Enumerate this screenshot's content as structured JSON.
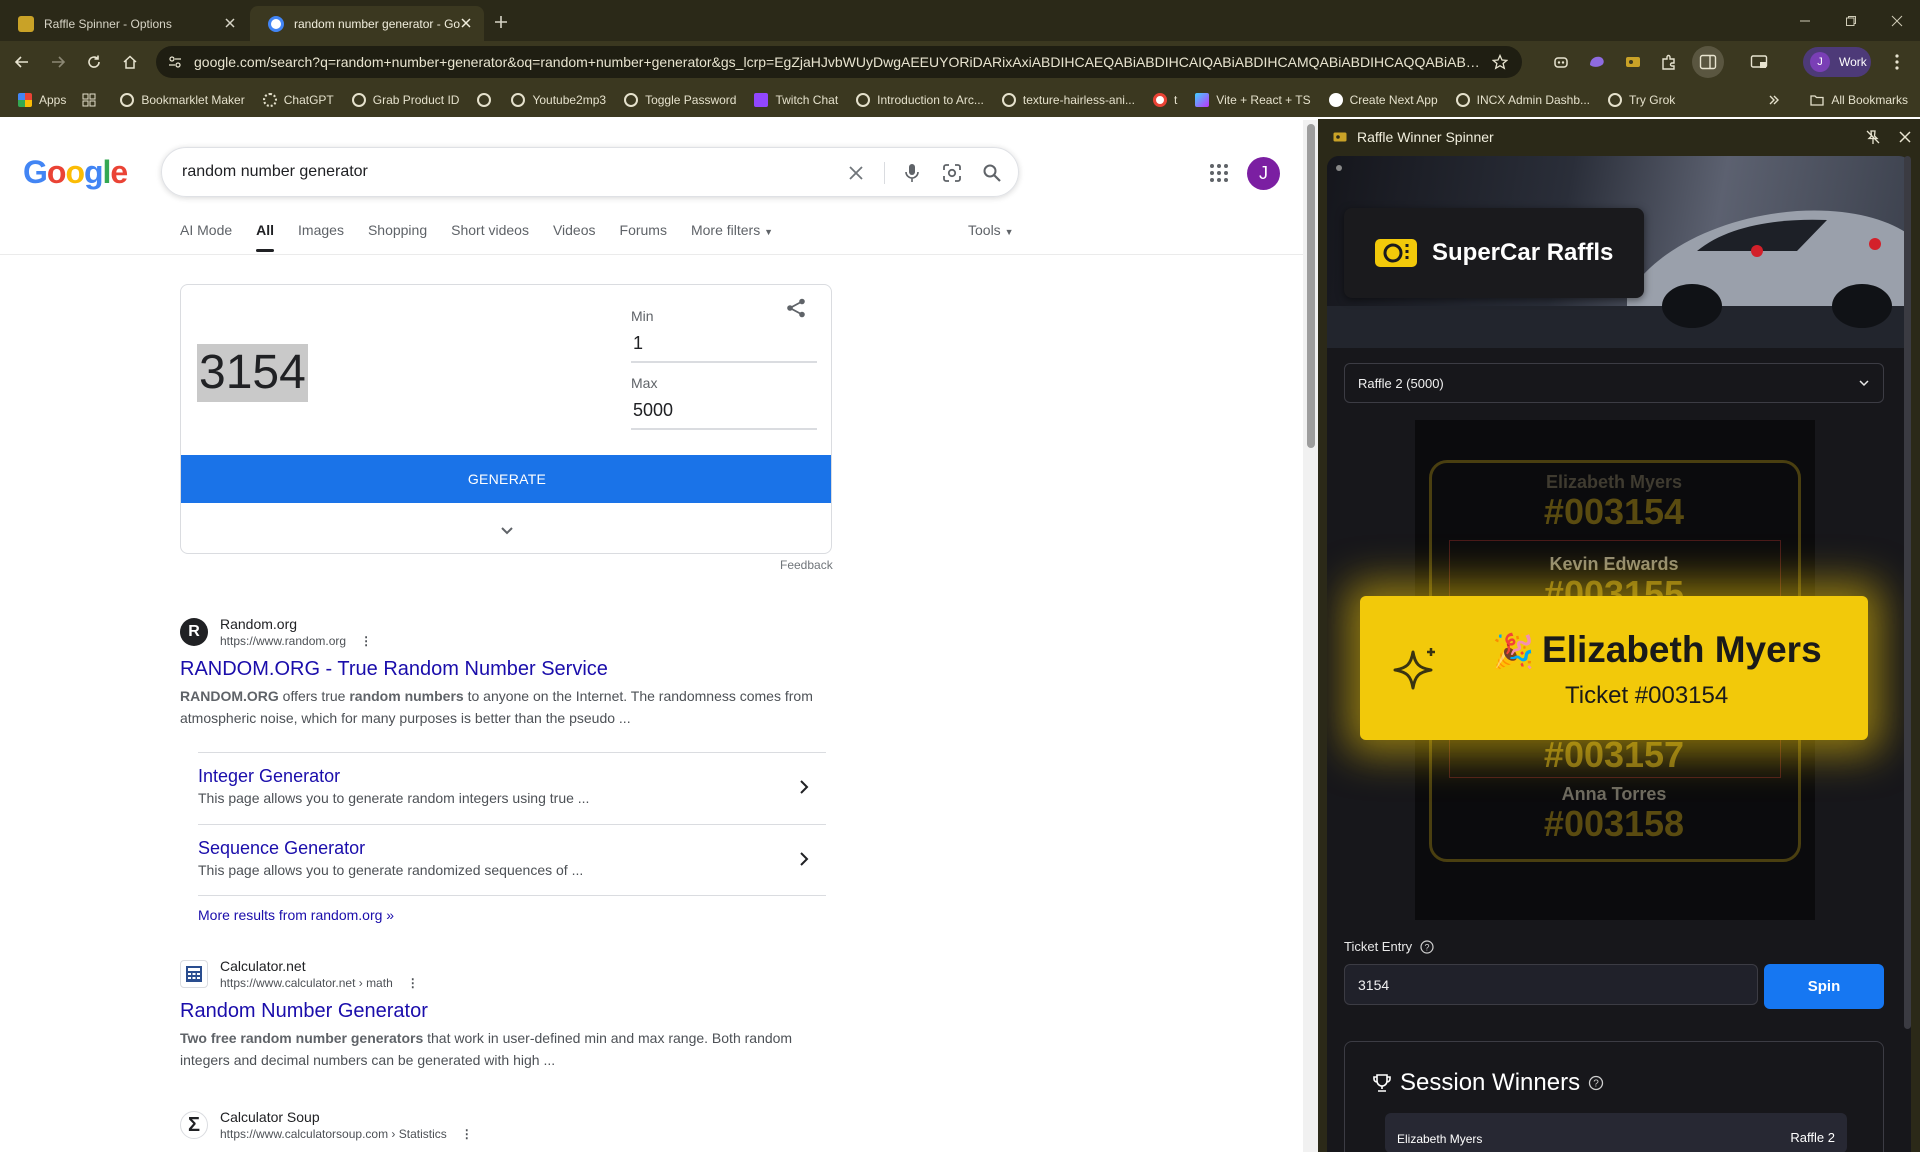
{
  "browser": {
    "tabs": [
      {
        "title": "Raffle Spinner - Options",
        "active": false
      },
      {
        "title": "random number generator - Go",
        "active": true
      }
    ],
    "url": "google.com/search?q=random+number+generator&oq=random+number+generator&gs_lcrp=EgZjaHJvbWUyDwgAEEUYORiDARixAxiABDIHCAEQABiABDIHCAIQABiABDIHCAMQABiABDIHCAQQABiABDIHCA...",
    "profile_label": "Work",
    "profile_initial": "J",
    "bookmarks": [
      "Apps",
      "Bookmarklet Maker",
      "ChatGPT",
      "Grab Product ID",
      "",
      "Youtube2mp3",
      "Toggle Password",
      "Twitch Chat",
      "Introduction to Arc...",
      "texture-hairless-ani...",
      "t",
      "Vite + React + TS",
      "Create Next App",
      "INCX Admin Dashb...",
      "Try Grok"
    ],
    "all_bookmarks": "All Bookmarks"
  },
  "google": {
    "query": "random number generator",
    "avatar_initial": "J",
    "nav_tabs": [
      "AI Mode",
      "All",
      "Images",
      "Shopping",
      "Short videos",
      "Videos",
      "Forums",
      "More filters"
    ],
    "tools": "Tools",
    "rng": {
      "result": "3154",
      "min_label": "Min",
      "min_value": "1",
      "max_label": "Max",
      "max_value": "5000",
      "generate": "GENERATE",
      "feedback": "Feedback"
    },
    "results": [
      {
        "site": "Random.org",
        "url": "https://www.random.org",
        "title": "RANDOM.ORG - True Random Number Service",
        "desc_parts": [
          "RANDOM.ORG",
          " offers true ",
          "random numbers",
          " to anyone on the Internet. The randomness comes from atmospheric noise, which for many purposes is better than the pseudo ..."
        ],
        "sublinks": [
          {
            "title": "Integer Generator",
            "desc": "This page allows you to generate random integers using true ..."
          },
          {
            "title": "Sequence Generator",
            "desc": "This page allows you to generate randomized sequences of ..."
          }
        ],
        "more": "More results from random.org »"
      },
      {
        "site": "Calculator.net",
        "url": "https://www.calculator.net › math",
        "title": "Random Number Generator",
        "desc_parts": [
          "Two free random number generators",
          " that work in user-defined min and max range. Both random integers and decimal numbers can be generated with high ..."
        ]
      },
      {
        "site": "Calculator Soup",
        "url": "https://www.calculatorsoup.com › Statistics"
      }
    ]
  },
  "panel": {
    "title": "Raffle Winner Spinner",
    "brand": "SuperCar Raffls",
    "raffle_select": "Raffle 2 (5000)",
    "reel": [
      {
        "name": "Elizabeth Myers",
        "ticket": "#003154"
      },
      {
        "name": "Kevin Edwards",
        "ticket": "#003155"
      },
      {
        "name": "",
        "ticket": "#003157"
      },
      {
        "name": "Anna Torres",
        "ticket": "#003158"
      }
    ],
    "winner": {
      "name": "Elizabeth Myers",
      "ticket": "Ticket #003154",
      "emoji": "🎉"
    },
    "ticket_entry_label": "Ticket Entry",
    "ticket_entry_value": "3154",
    "spin_label": "Spin",
    "session_winners_title": "Session Winners",
    "session_winners": [
      {
        "name": "Elizabeth Myers",
        "raffle": "Raffle 2"
      }
    ]
  },
  "colors": {
    "chrome_dark": "#2b2918",
    "chrome_toolbar": "#3b3820",
    "google_blue": "#1a73e8",
    "link_blue": "#1a0dab",
    "winner_yellow": "#f2c90a",
    "spin_blue": "#1677f2"
  }
}
